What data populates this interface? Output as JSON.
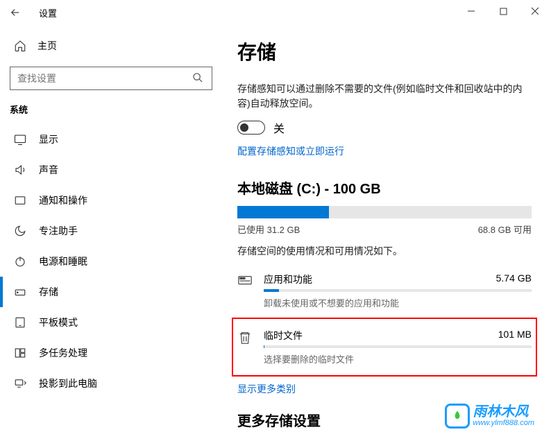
{
  "titlebar": {
    "title": "设置"
  },
  "sidebar": {
    "home": "主页",
    "search_placeholder": "查找设置",
    "section": "系统",
    "items": [
      {
        "label": "显示"
      },
      {
        "label": "声音"
      },
      {
        "label": "通知和操作"
      },
      {
        "label": "专注助手"
      },
      {
        "label": "电源和睡眠"
      },
      {
        "label": "存储"
      },
      {
        "label": "平板模式"
      },
      {
        "label": "多任务处理"
      },
      {
        "label": "投影到此电脑"
      }
    ]
  },
  "main": {
    "title": "存储",
    "sense_desc": "存储感知可以通过删除不需要的文件(例如临时文件和回收站中的内容)自动释放空间。",
    "toggle_label": "关",
    "config_link": "配置存储感知或立即运行",
    "disk_heading": "本地磁盘 (C:) - 100 GB",
    "disk_used_pct": 31.2,
    "disk_used_label": "已使用 31.2 GB",
    "disk_free_label": "68.8 GB 可用",
    "usage_desc": "存储空间的使用情况和可用情况如下。",
    "items": [
      {
        "name": "应用和功能",
        "size": "5.74 GB",
        "sub": "卸载未使用或不想要的应用和功能",
        "pct": 5.74
      },
      {
        "name": "临时文件",
        "size": "101 MB",
        "sub": "选择要删除的临时文件",
        "pct": 0.1
      }
    ],
    "show_more": "显示更多类别",
    "more_settings": "更多存储设置"
  },
  "watermark": {
    "text": "雨林木风",
    "url": "www.ylmf888.com"
  }
}
